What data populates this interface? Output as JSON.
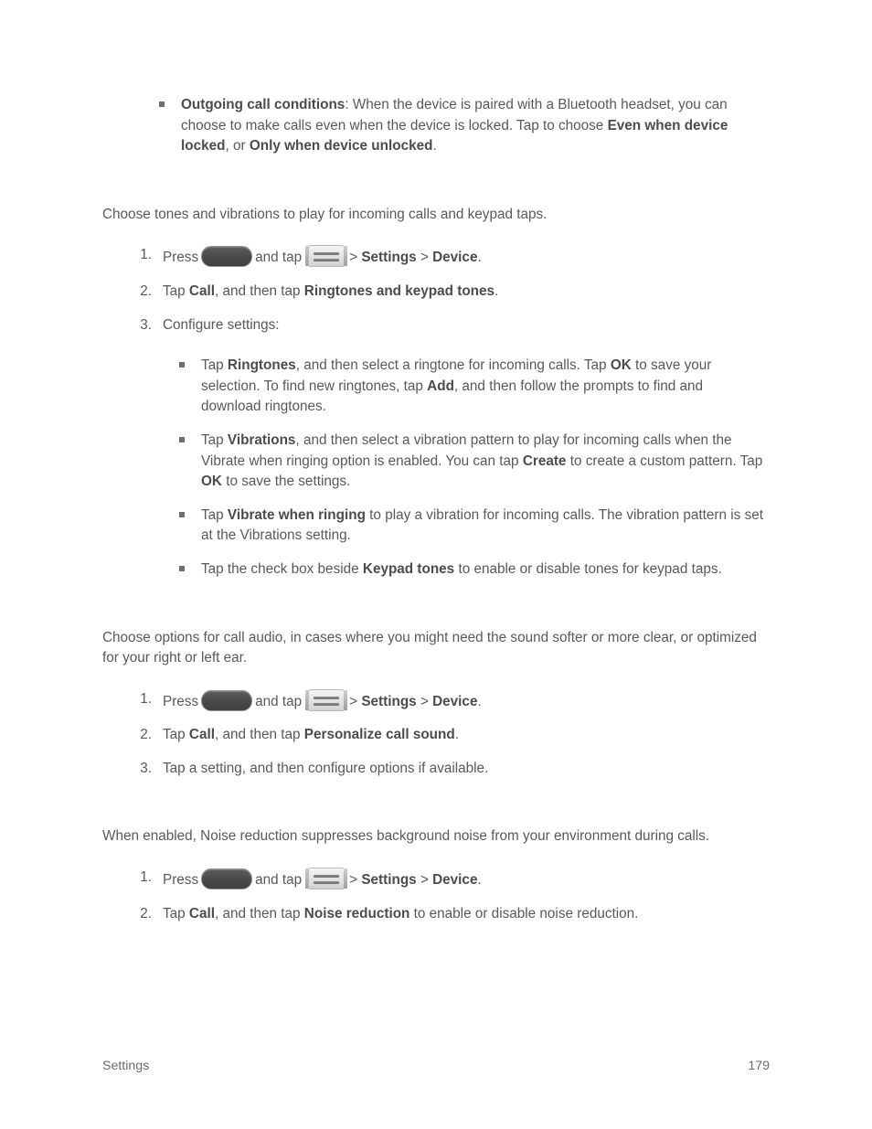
{
  "page": {
    "footer_left": "Settings",
    "footer_page_number": "179"
  },
  "icons": {
    "home_button": "home-button-icon",
    "menu_button": "menu-icon"
  },
  "blocks": {
    "outgoing_call_conditions": {
      "bold_lead": "Outgoing call conditions",
      "text_1": ": When the device is paired with a Bluetooth headset, you can choose to make calls even when the device is locked. Tap to choose ",
      "bold_2": "Even when device locked",
      "text_2": ", or ",
      "bold_3": "Only when device unlocked",
      "text_3": "."
    },
    "ringtones_intro": "Choose tones and vibrations to play for incoming calls and keypad taps.",
    "ringtones_steps": {
      "step1": {
        "num": "1.",
        "press_label": "Press",
        "and_tap_label": "and tap",
        "gt1": ">",
        "bold_settings": "Settings",
        "gt2": ">",
        "bold_device": "Device",
        "period": "."
      },
      "step2": {
        "num": "2.",
        "text_1": "Tap ",
        "bold_1": "Call",
        "text_2": ", and then tap ",
        "bold_2": "Ringtones and keypad tones",
        "text_3": "."
      },
      "step3": {
        "num": "3.",
        "text_1": "Configure settings:"
      }
    },
    "ringtones_substeps": [
      {
        "text_1": "Tap ",
        "bold_1": "Ringtones",
        "text_2": ", and then select a ringtone for incoming calls. Tap ",
        "bold_2": "OK",
        "text_3": " to save your selection. To find new ringtones, tap ",
        "bold_3": "Add",
        "text_4": ", and then follow the prompts to find and download ringtones."
      },
      {
        "text_1": "Tap ",
        "bold_1": "Vibrations",
        "text_2": ", and then select a vibration pattern to play for incoming calls when the Vibrate when ringing option is enabled. You can tap ",
        "bold_2": "Create",
        "text_3": " to create a custom pattern. Tap ",
        "bold_3": "OK",
        "text_4": " to save the settings."
      },
      {
        "text_1": "Tap ",
        "bold_1": "Vibrate when ringing",
        "text_2": " to play a vibration for incoming calls. The vibration pattern is set at the Vibrations setting.",
        "bold_2": "",
        "text_3": "",
        "bold_3": "",
        "text_4": ""
      },
      {
        "text_1": "Tap the check box beside ",
        "bold_1": "Keypad tones",
        "text_2": " to enable or disable tones for keypad taps.",
        "bold_2": "",
        "text_3": "",
        "bold_3": "",
        "text_4": ""
      }
    ],
    "call_audio_intro": "Choose options for call audio, in cases where you might need the sound softer or more clear, or optimized for your right or left ear.",
    "call_audio_steps": {
      "step1": {
        "num": "1.",
        "press_label": "Press",
        "and_tap_label": "and tap",
        "gt1": ">",
        "bold_settings": "Settings",
        "gt2": ">",
        "bold_device": "Device",
        "period": "."
      },
      "step2": {
        "num": "2.",
        "text_1": "Tap ",
        "bold_1": "Call",
        "text_2": ", and then tap ",
        "bold_2": "Personalize call sound",
        "text_3": "."
      },
      "step3": {
        "num": "3.",
        "text_1": "Tap a setting, and then configure options if available."
      }
    },
    "noise_reduction_intro": "When enabled, Noise reduction suppresses background noise from your environment during calls.",
    "noise_reduction_steps": {
      "step1": {
        "num": "1.",
        "press_label": "Press",
        "and_tap_label": "and tap",
        "gt1": ">",
        "bold_settings": "Settings",
        "gt2": ">",
        "bold_device": "Device",
        "period": "."
      },
      "step2": {
        "num": "2.",
        "text_1": "Tap ",
        "bold_1": "Call",
        "text_2": ", and then tap ",
        "bold_2": "Noise reduction",
        "text_3": " to enable or disable noise reduction."
      }
    }
  },
  "colors": {
    "body_text": "#58595b",
    "bold_text": "#4b4c4e",
    "bullet": "#6d6e70",
    "background": "#ffffff"
  }
}
